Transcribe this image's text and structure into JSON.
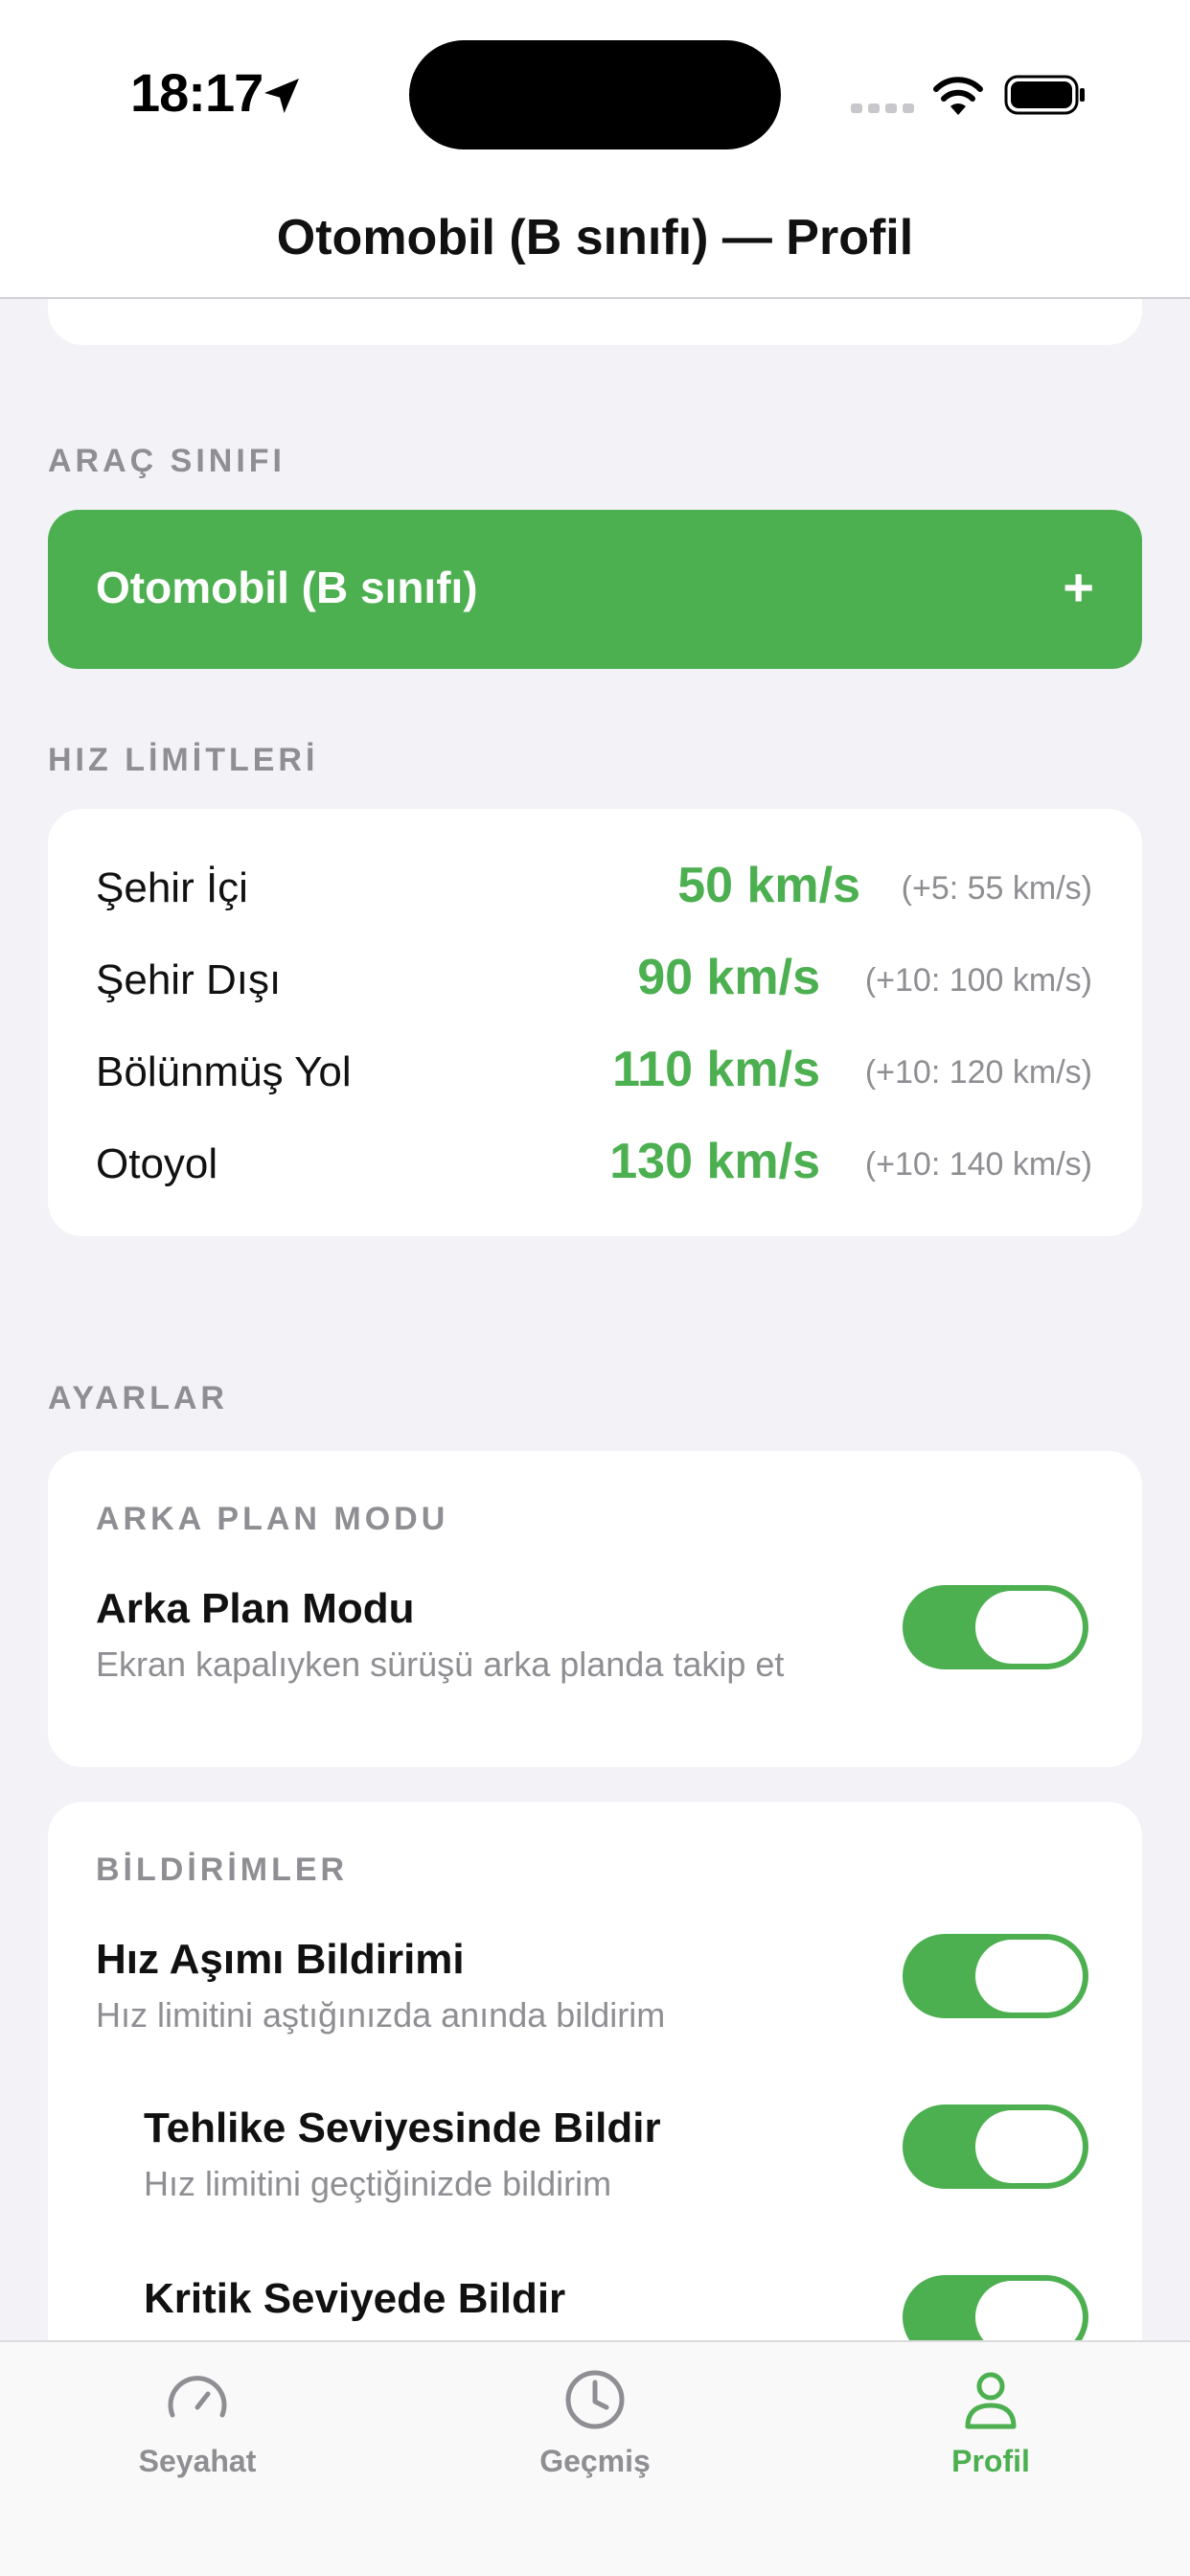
{
  "status_bar": {
    "time": "18:17"
  },
  "nav": {
    "title": "Otomobil (B sınıfı) — Profil"
  },
  "vehicle_class": {
    "section_label": "ARAÇ SINIFI",
    "selected": "Otomobil (B sınıfı)",
    "action_symbol": "+"
  },
  "speed_limits": {
    "section_label": "HIZ LİMİTLERİ",
    "rows": [
      {
        "name": "Şehir İçi",
        "limit": "50 km/s",
        "tolerance": "(+5: 55 km/s)"
      },
      {
        "name": "Şehir Dışı",
        "limit": "90 km/s",
        "tolerance": "(+10: 100 km/s)"
      },
      {
        "name": "Bölünmüş Yol",
        "limit": "110 km/s",
        "tolerance": "(+10: 120 km/s)"
      },
      {
        "name": "Otoyol",
        "limit": "130 km/s",
        "tolerance": "(+10: 140 km/s)"
      }
    ]
  },
  "settings": {
    "section_label": "AYARLAR",
    "background_mode": {
      "card_label": "ARKA PLAN MODU",
      "title": "Arka Plan Modu",
      "description": "Ekran kapalıyken sürüşü arka planda takip et",
      "enabled": true
    },
    "notifications": {
      "card_label": "BİLDİRİMLER",
      "items": [
        {
          "title": "Hız Aşımı Bildirimi",
          "description": "Hız limitini aştığınızda anında bildirim",
          "enabled": true
        },
        {
          "title": "Tehlike Seviyesinde Bildir",
          "description": "Hız limitini geçtiğinizde bildirim",
          "enabled": true
        },
        {
          "title": "Kritik Seviyede Bildir",
          "enabled": true
        }
      ]
    }
  },
  "tabbar": {
    "tabs": [
      {
        "label": "Seyahat",
        "icon": "speedometer-icon",
        "active": false
      },
      {
        "label": "Geçmiş",
        "icon": "clock-icon",
        "active": false
      },
      {
        "label": "Profil",
        "icon": "person-icon",
        "active": true
      }
    ]
  },
  "colors": {
    "accent": "#4caf50",
    "background": "#f2f2f7",
    "secondary_text": "#8e8e93"
  }
}
